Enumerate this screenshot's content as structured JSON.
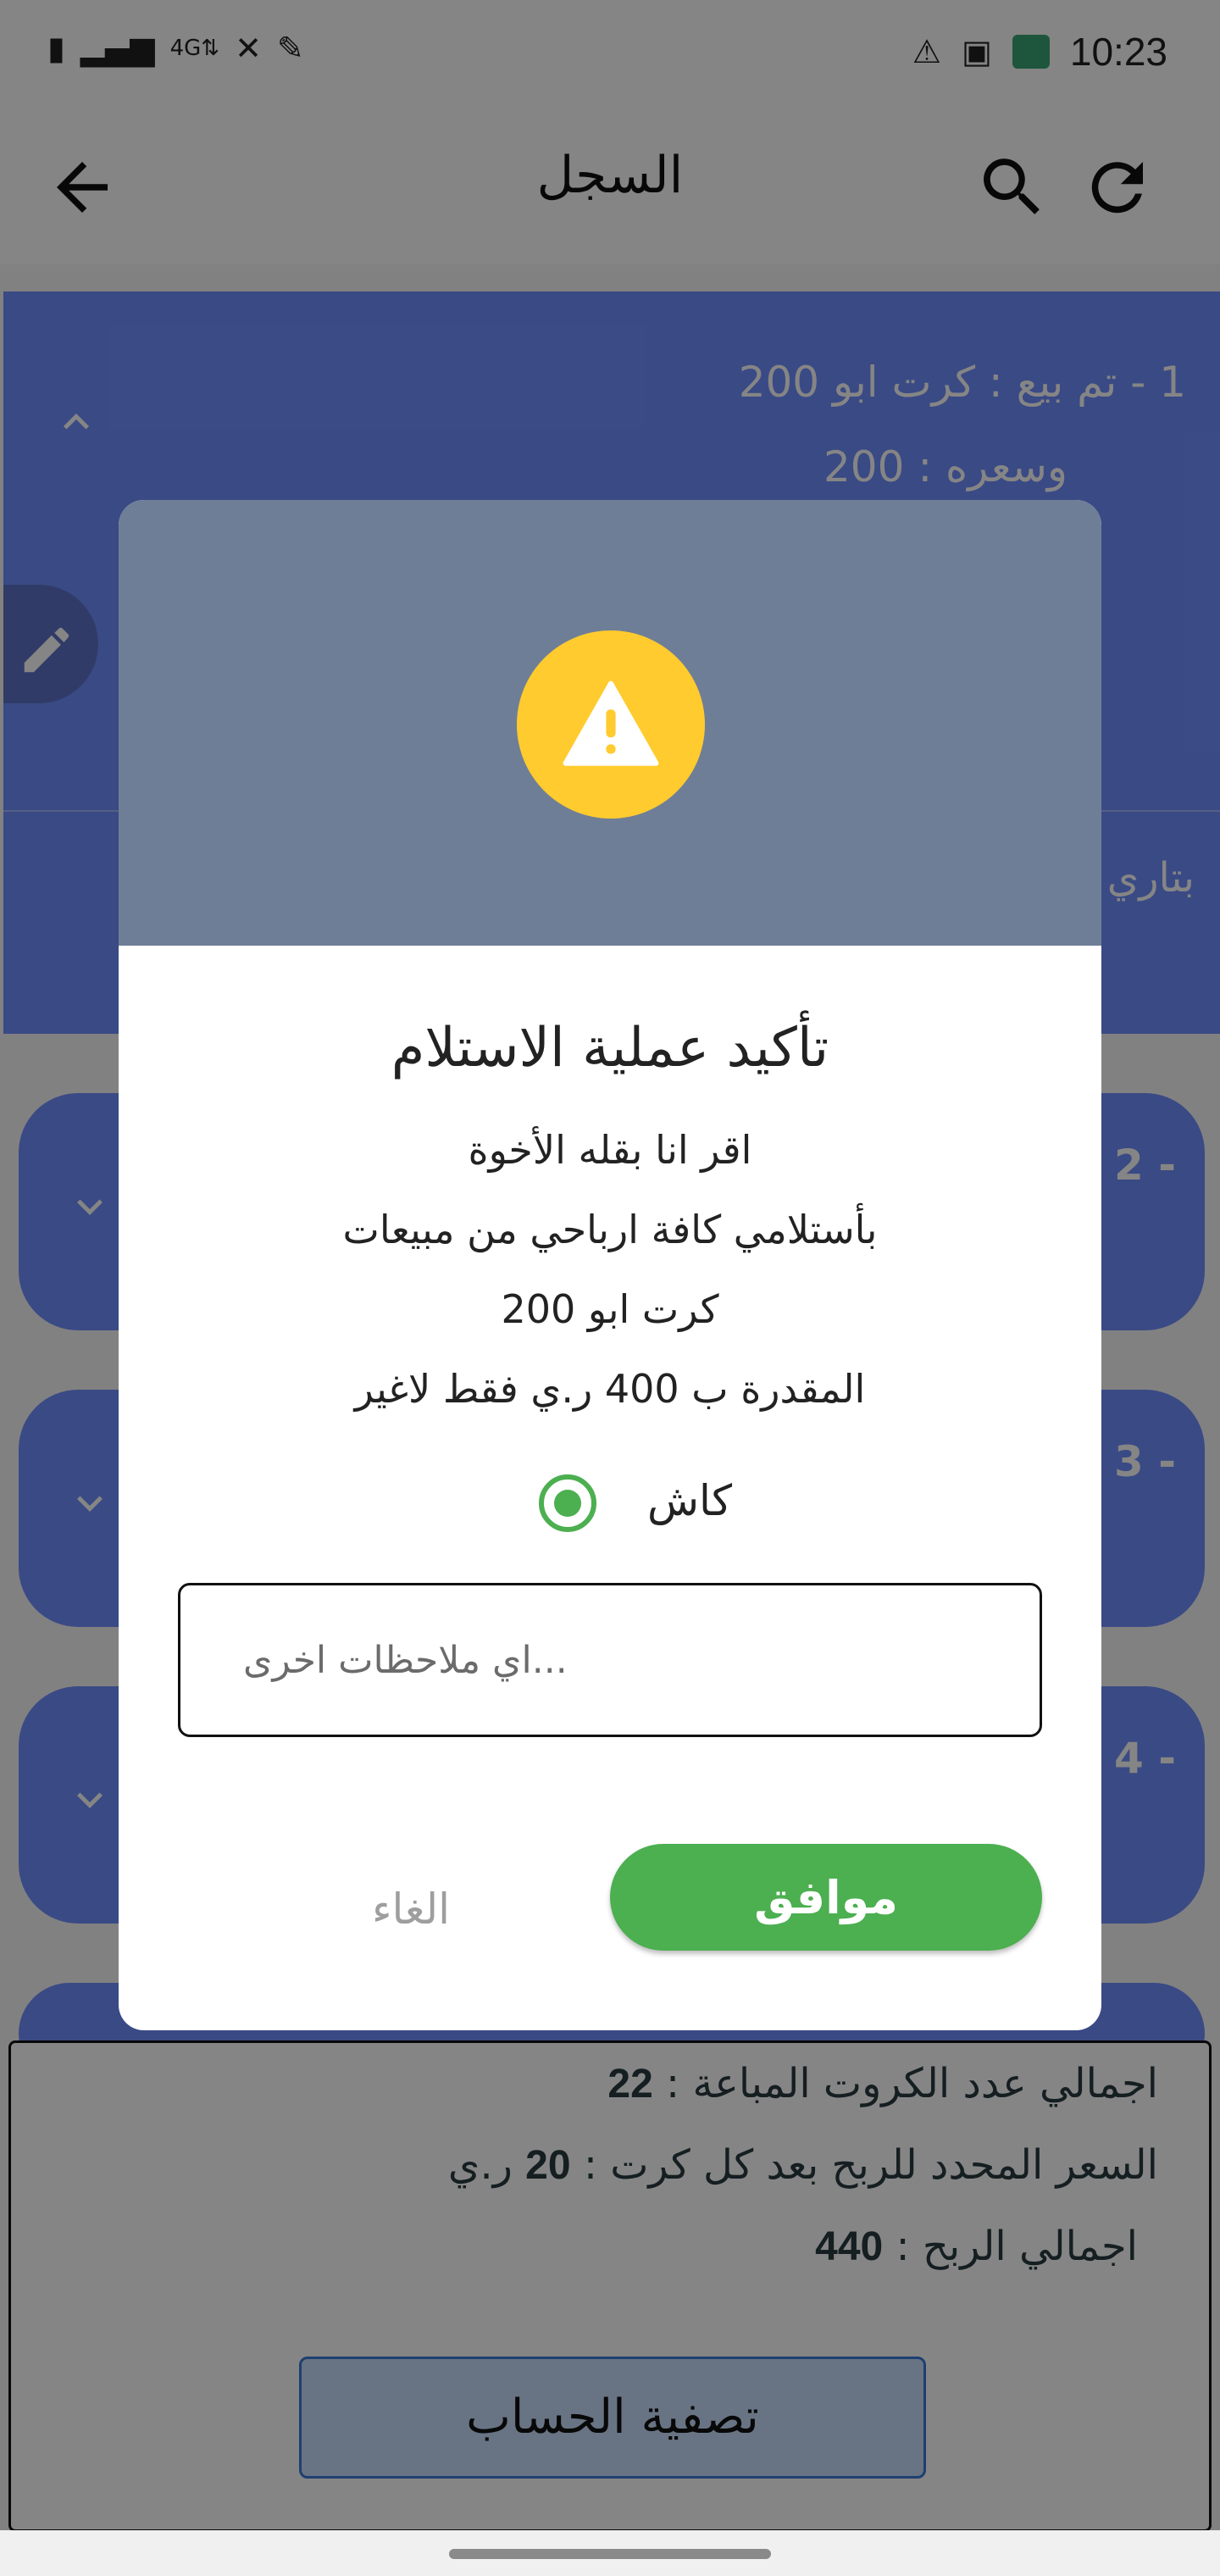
{
  "status_bar": {
    "time": "10:23",
    "left_icons": [
      "battery-charging-icon",
      "signal-icon",
      "4g-lte-icon",
      "mute-icon",
      "pen-icon"
    ],
    "right_icons": [
      "warning-icon",
      "image-icon",
      "app-notification-icon"
    ]
  },
  "app_bar": {
    "title": "السجل"
  },
  "cards": [
    {
      "number": "1",
      "line1": "1  -  تم بيع : كرت  ابو 200",
      "line2": "وسعره  :  200",
      "date_label": "بتاري"
    },
    {
      "number": "2 -"
    },
    {
      "number": "3 -"
    },
    {
      "number": "4 -"
    }
  ],
  "summary": {
    "total_cards_label": "اجمالي عدد الكروت المباعة  :",
    "total_cards_value": "22",
    "profit_per_card_label": "السعر المحدد للربح بعد كل كرت  :",
    "profit_per_card_value": "20",
    "profit_per_card_unit": "ر.ي",
    "total_profit_label": "اجمالي الربح   :",
    "total_profit_value": "440",
    "settle_button": "تصفية الحساب"
  },
  "dialog": {
    "title": "تأكيد عملية الاستلام",
    "message_lines": [
      "اقر انا  بقله الأخوة",
      "بأستلامي كافة ارباحي من مبيعات",
      "كرت  ابو 200",
      "المقدرة ب    400  ر.ي فقط لاغير"
    ],
    "radio_label": "كاش",
    "radio_checked": true,
    "notes_placeholder": "...اي ملاحظات اخرى",
    "notes_value": "",
    "cancel_label": "الغاء",
    "ok_label": "موافق",
    "colors": {
      "header": "#6f7e97",
      "warning": "#ffcb2e",
      "primary": "#4caf50",
      "card": "#6f8fff"
    }
  }
}
